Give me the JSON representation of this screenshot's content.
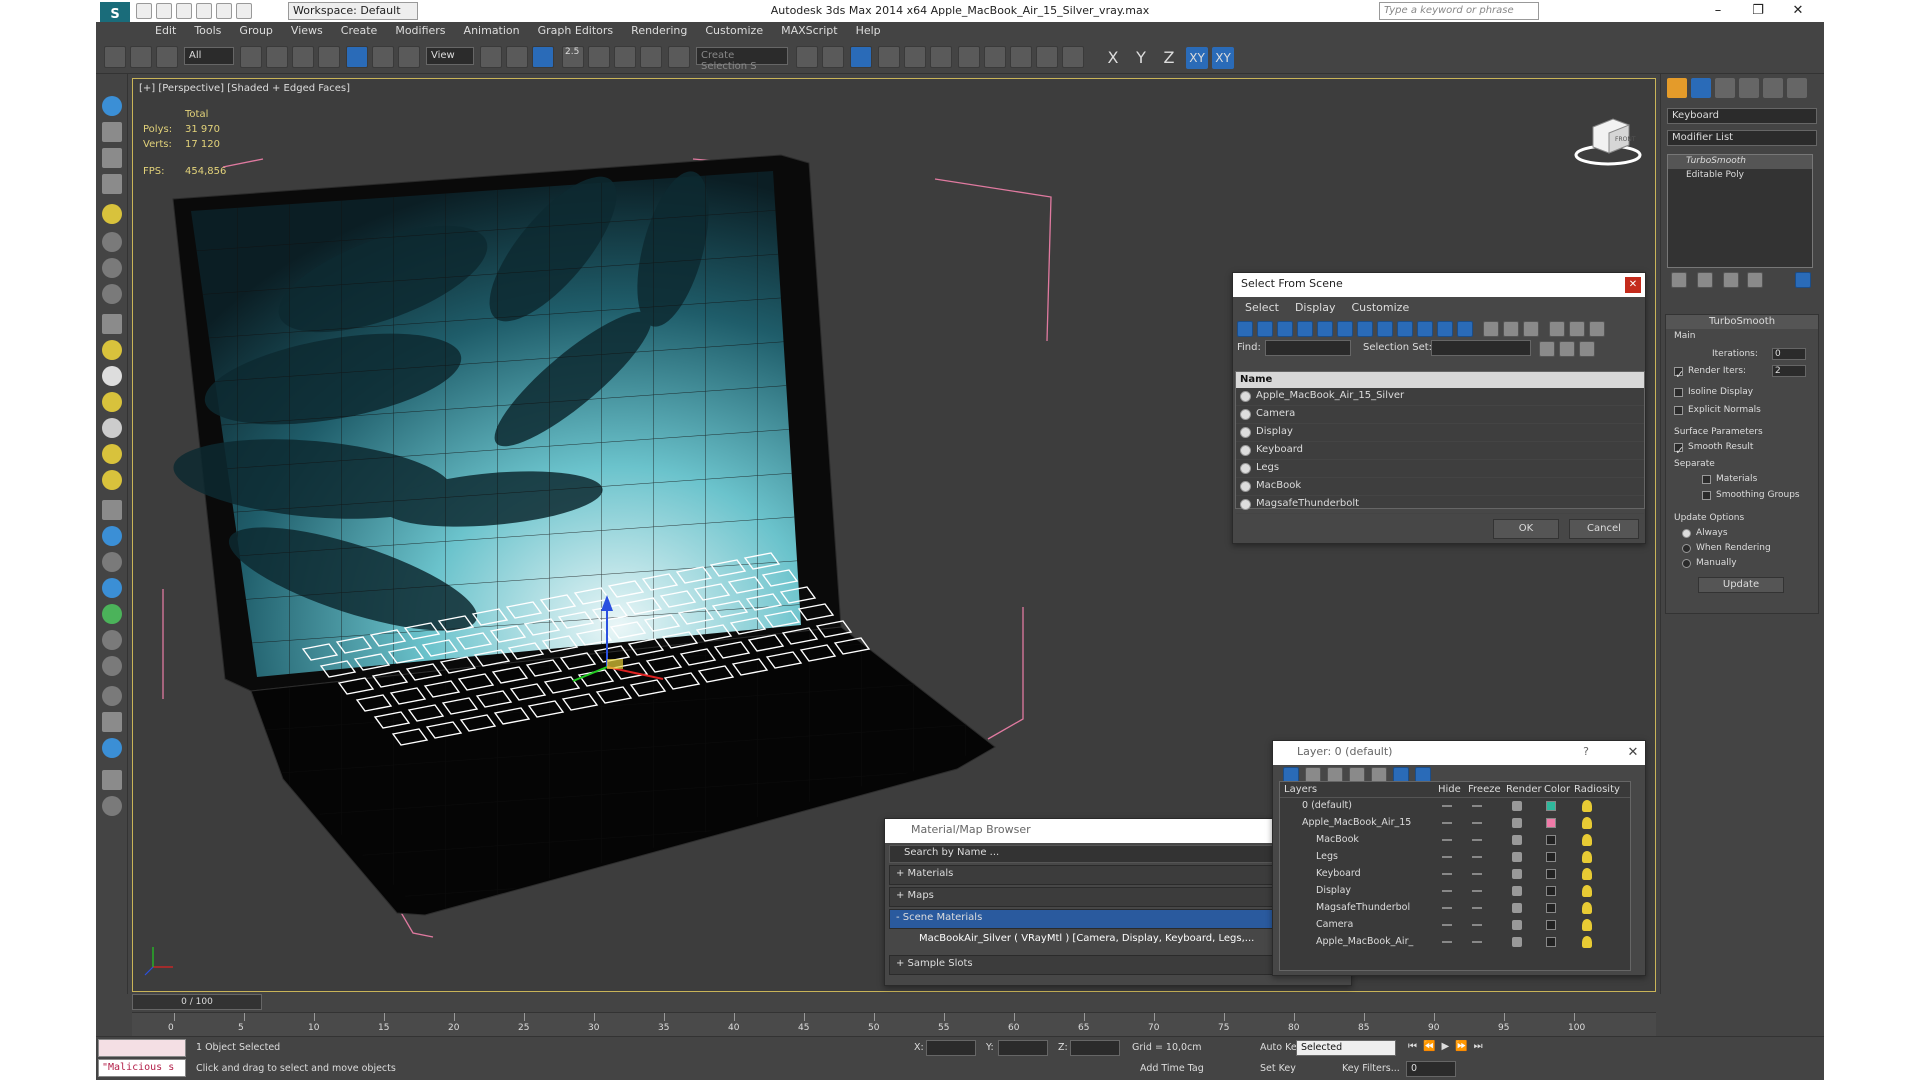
{
  "window": {
    "title": "Autodesk 3ds Max  2014 x64     Apple_MacBook_Air_15_Silver_vray.max",
    "workspace": "Workspace: Default",
    "search_placeholder": "Type a keyword or phrase"
  },
  "menu": [
    "Edit",
    "Tools",
    "Group",
    "Views",
    "Create",
    "Modifiers",
    "Animation",
    "Graph Editors",
    "Rendering",
    "Customize",
    "MAXScript",
    "Help"
  ],
  "toolbar": {
    "filter": "All",
    "ref_coord": "View",
    "angle_snap": "2.5",
    "selection_set_placeholder": "Create Selection S",
    "axes": [
      "X",
      "Y",
      "Z",
      "XY",
      "XY"
    ]
  },
  "viewport": {
    "label": "[+] [Perspective] [Shaded + Edged Faces]",
    "stats": {
      "total_label": "Total",
      "polys_label": "Polys:",
      "polys": "31 970",
      "verts_label": "Verts:",
      "verts": "17 120",
      "fps_label": "FPS:",
      "fps": "454,856"
    },
    "viewcube_label": "FRONT"
  },
  "select_from_scene": {
    "title": "Select From Scene",
    "menu": [
      "Select",
      "Display",
      "Customize"
    ],
    "find_label": "Find:",
    "selection_set_label": "Selection Set:",
    "column": "Name",
    "items": [
      "Apple_MacBook_Air_15_Silver",
      "Camera",
      "Display",
      "Keyboard",
      "Legs",
      "MacBook",
      "MagsafeThunderbolt"
    ],
    "ok": "OK",
    "cancel": "Cancel"
  },
  "command_panel": {
    "object_name": "Keyboard",
    "modifier_list": "Modifier List",
    "stack": [
      "TurboSmooth",
      "Editable Poly"
    ],
    "turbosmooth": {
      "title": "TurboSmooth",
      "main": "Main",
      "iterations_label": "Iterations:",
      "iterations": "0",
      "render_iters_label": "Render Iters:",
      "render_iters": "2",
      "isoline": "Isoline Display",
      "explicit": "Explicit Normals",
      "surface_params": "Surface Parameters",
      "smooth_result": "Smooth Result",
      "separate": "Separate",
      "materials": "Materials",
      "smoothing_groups": "Smoothing Groups",
      "update_options": "Update Options",
      "always": "Always",
      "when_rendering": "When Rendering",
      "manually": "Manually",
      "update": "Update"
    }
  },
  "layers": {
    "title": "Layer: 0 (default)",
    "help": "?",
    "columns": [
      "Layers",
      "Hide",
      "Freeze",
      "Render",
      "Color",
      "Radiosity"
    ],
    "rows": [
      {
        "name": "0 (default)",
        "indent": 0,
        "color": "#2fb89c",
        "check": true
      },
      {
        "name": "Apple_MacBook_Air_15",
        "indent": 0,
        "color": "#f07aa8",
        "check": false
      },
      {
        "name": "MacBook",
        "indent": 1,
        "color": "#222222"
      },
      {
        "name": "Legs",
        "indent": 1,
        "color": "#222222"
      },
      {
        "name": "Keyboard",
        "indent": 1,
        "color": "#222222"
      },
      {
        "name": "Display",
        "indent": 1,
        "color": "#222222"
      },
      {
        "name": "MagsafeThunderbol",
        "indent": 1,
        "color": "#222222"
      },
      {
        "name": "Camera",
        "indent": 1,
        "color": "#222222"
      },
      {
        "name": "Apple_MacBook_Air_",
        "indent": 1,
        "color": "#222222"
      }
    ]
  },
  "material_browser": {
    "title": "Material/Map Browser",
    "search_placeholder": "Search by Name ...",
    "sections": [
      "+ Materials",
      "+ Maps",
      "- Scene Materials"
    ],
    "scene_material": "MacBookAir_Silver ( VRayMtl ) [Camera, Display, Keyboard, Legs,...",
    "sample_slots": "+ Sample Slots"
  },
  "timeline": {
    "slider": "0 / 100",
    "ticks": [
      "0",
      "5",
      "10",
      "15",
      "20",
      "25",
      "30",
      "35",
      "40",
      "45",
      "50",
      "55",
      "60",
      "65",
      "70",
      "75",
      "80",
      "85",
      "90",
      "95",
      "100"
    ]
  },
  "status": {
    "maxscript": "\"Malicious s",
    "selected": "1 Object Selected",
    "prompt": "Click and drag to select and move objects",
    "x_label": "X:",
    "y_label": "Y:",
    "z_label": "Z:",
    "grid": "Grid = 10,0cm",
    "add_time_tag": "Add Time Tag",
    "auto_key": "Auto Key",
    "set_key": "Set Key",
    "selected_dropdown": "Selected",
    "key_filters": "Key Filters...",
    "frame": "0"
  },
  "colors": {
    "accent": "#2a6bb8",
    "viewport_bg": "#3d3d3d",
    "screen_teal": "#5fb7c2",
    "bbox_pink": "#e07aa0"
  }
}
